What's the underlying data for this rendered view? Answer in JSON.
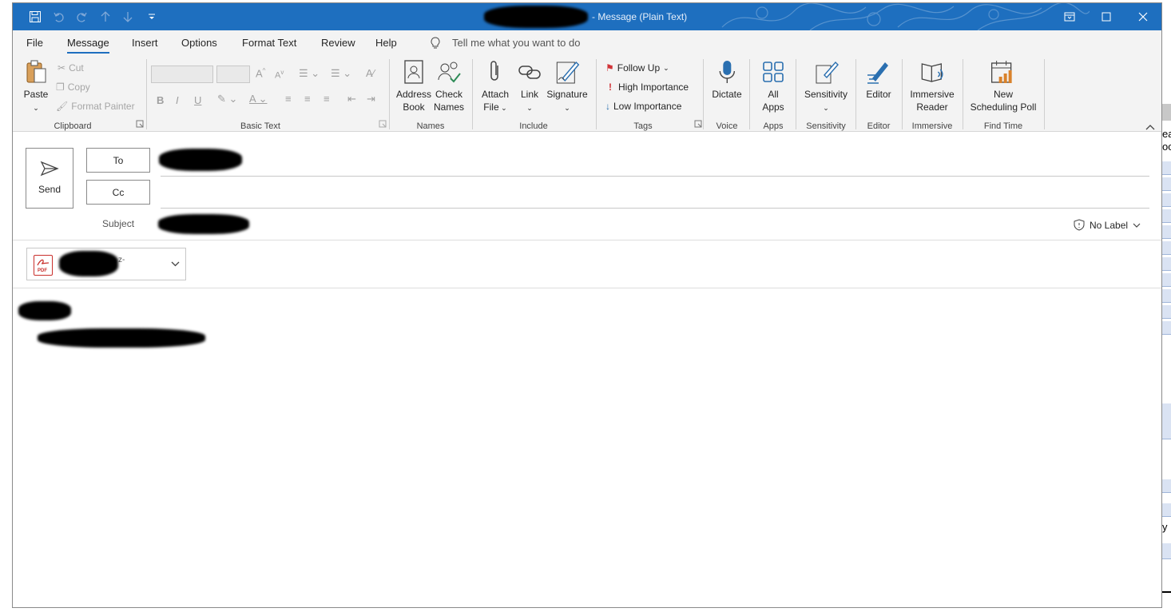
{
  "window": {
    "title_suffix": "- Message (Plain Text)",
    "colors": {
      "titlebar": "#1e6fbf",
      "ribbon": "#f3f3f3",
      "accent": "#1e6fbf"
    }
  },
  "quick_access": [
    {
      "name": "save-icon"
    },
    {
      "name": "undo-icon"
    },
    {
      "name": "redo-icon"
    },
    {
      "name": "up-arrow-icon"
    },
    {
      "name": "down-arrow-icon"
    },
    {
      "name": "customize-toolbar-icon"
    }
  ],
  "menu": {
    "tabs": [
      "File",
      "Message",
      "Insert",
      "Options",
      "Format Text",
      "Review",
      "Help"
    ],
    "active_tab": "Message",
    "tell_me": "Tell me what you want to do"
  },
  "ribbon": {
    "clipboard": {
      "label": "Clipboard",
      "paste": "Paste",
      "cut": "Cut",
      "copy": "Copy",
      "format_painter": "Format Painter"
    },
    "basic_text": {
      "label": "Basic Text",
      "bold": "B",
      "italic": "I",
      "underline": "U"
    },
    "names": {
      "label": "Names",
      "address_book": [
        "Address",
        "Book"
      ],
      "check_names": [
        "Check",
        "Names"
      ]
    },
    "include": {
      "label": "Include",
      "attach_file": [
        "Attach",
        "File"
      ],
      "link": "Link",
      "signature": "Signature"
    },
    "tags": {
      "label": "Tags",
      "follow_up": "Follow Up",
      "high_importance": "High Importance",
      "low_importance": "Low Importance"
    },
    "voice": {
      "label": "Voice",
      "dictate": "Dictate"
    },
    "apps": {
      "label": "Apps",
      "all_apps": [
        "All",
        "Apps"
      ]
    },
    "sensitivity": {
      "label": "Sensitivity",
      "button": "Sensitivity"
    },
    "editor": {
      "label": "Editor",
      "button": "Editor"
    },
    "immersive": {
      "label": "Immersive",
      "button": [
        "Immersive",
        "Reader"
      ]
    },
    "find_time": {
      "label": "Find Time",
      "button": [
        "New",
        "Scheduling Poll"
      ]
    }
  },
  "compose": {
    "send": "Send",
    "to": "To",
    "cc": "Cc",
    "subject_label": "Subject",
    "sensitivity_label": "No Label",
    "attachment": {
      "type_badge": "PDF",
      "name_fragment": "z-"
    }
  },
  "bg_text": [
    "ea",
    "oc",
    "y"
  ]
}
